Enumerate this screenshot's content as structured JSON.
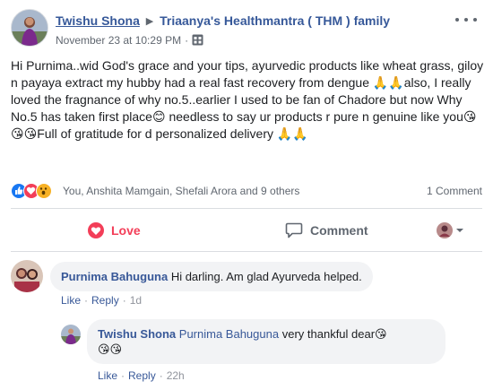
{
  "post": {
    "author": "Twishu Shona",
    "group": "Triaanya's Healthmantra ( THM ) family",
    "timestamp": "November 23 at 10:29 PM",
    "separator": "·",
    "audience_icon": "group-icon",
    "text": "Hi Purnima..wid God's grace and your tips, ayurvedic products like wheat grass, giloy n payaya extract my hubby had a real fast recovery from dengue 🙏🙏also, I really loved the fragnance of why no.5..earlier I used to be fan of Chadore but now Why No.5 has taken first place😊 needless to say ur products r pure n genuine like you😘😘😘Full of gratitude for d personalized delivery 🙏🙏"
  },
  "reactions": {
    "icons": [
      "like-reaction-icon",
      "love-reaction-icon",
      "wow-reaction-icon"
    ],
    "names": "You, Anshita Mamgain, Shefali Arora and 9 others",
    "comment_count": "1 Comment"
  },
  "actions": {
    "love_label": "Love",
    "comment_label": "Comment"
  },
  "comments": [
    {
      "author": "Purnima Bahuguna",
      "text": "Hi darling. Am glad Ayurveda helped.",
      "like_label": "Like",
      "reply_label": "Reply",
      "time": "1d"
    }
  ],
  "reply": {
    "author": "Twishu Shona",
    "mention": "Purnima Bahuguna",
    "text_line1": "very thankful dear😘",
    "text_line2": "😘😘",
    "like_label": "Like",
    "reply_label": "Reply",
    "time": "22h"
  },
  "colors": {
    "link": "#365899",
    "love": "#f33e58",
    "meta": "#606770",
    "bubble": "#f2f3f5"
  }
}
